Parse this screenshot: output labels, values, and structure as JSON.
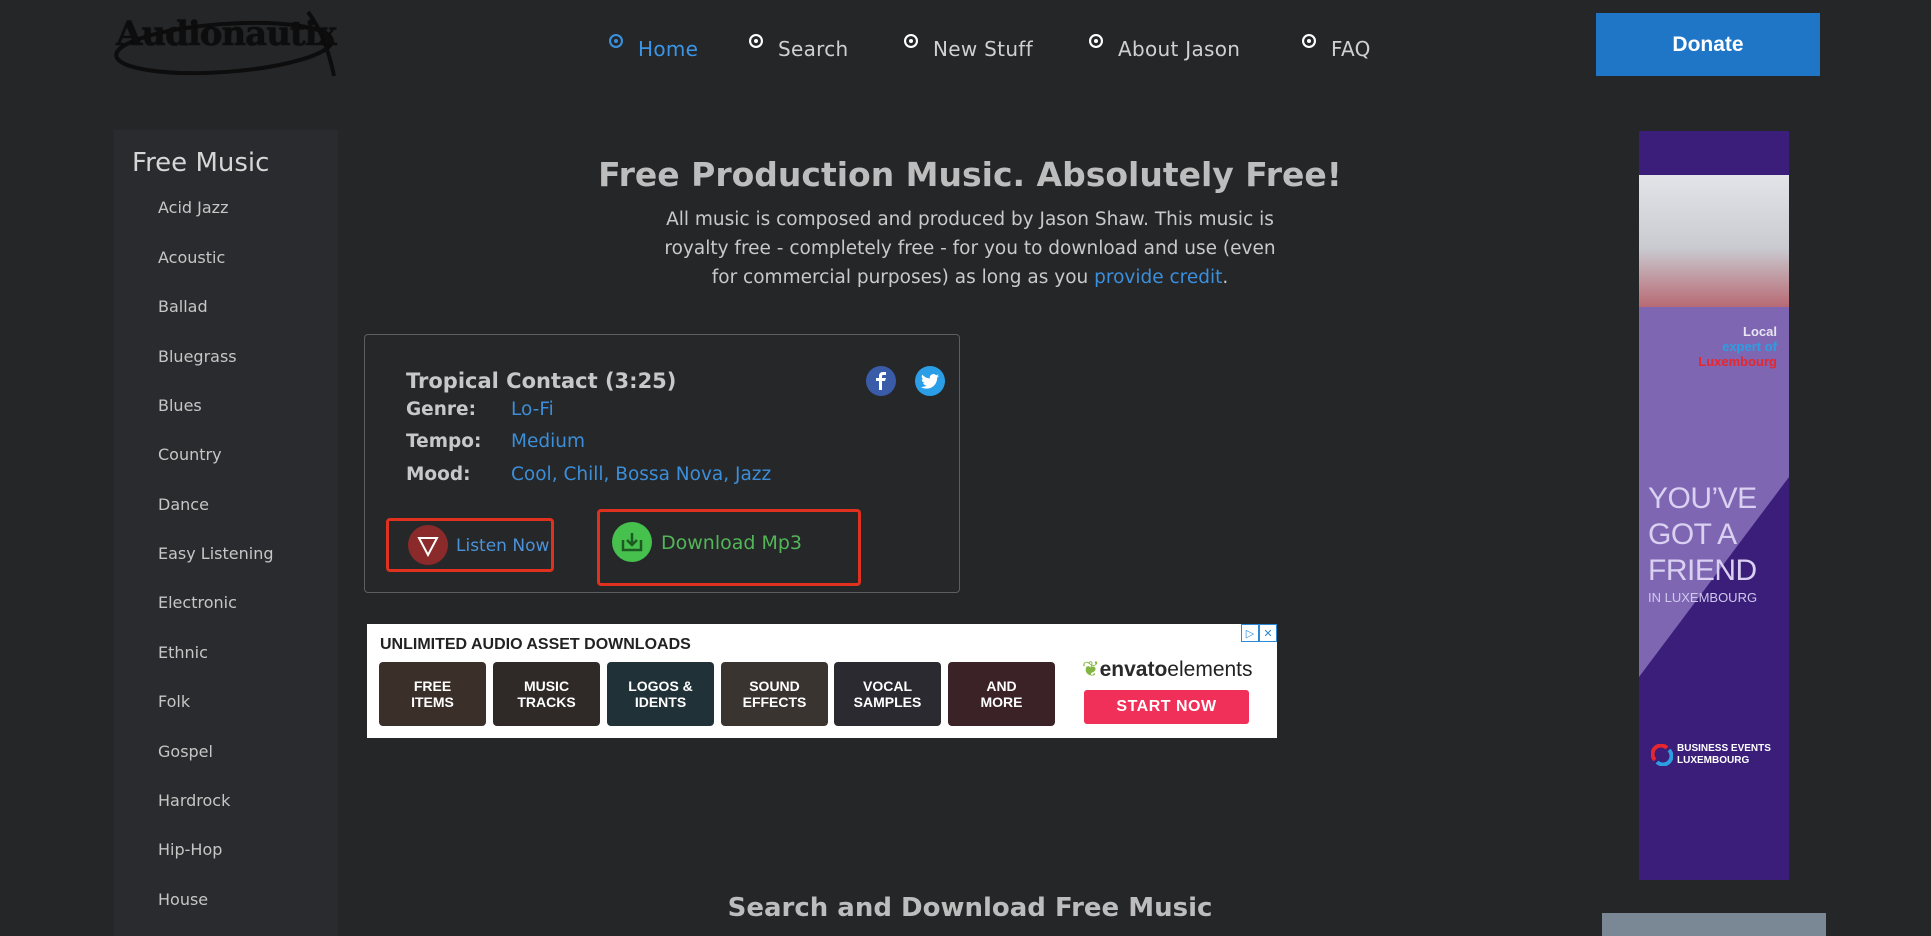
{
  "brand": {
    "logo_text": "Audionautix"
  },
  "nav": {
    "items": [
      {
        "label": "Home",
        "active": true
      },
      {
        "label": "Search",
        "active": false
      },
      {
        "label": "New Stuff",
        "active": false
      },
      {
        "label": "About Jason",
        "active": false
      },
      {
        "label": "FAQ",
        "active": false
      }
    ]
  },
  "donate": {
    "label": "Donate"
  },
  "sidebar": {
    "title": "Free Music",
    "items": [
      "Acid Jazz",
      "Acoustic",
      "Ballad",
      "Bluegrass",
      "Blues",
      "Country",
      "Dance",
      "Easy Listening",
      "Electronic",
      "Ethnic",
      "Folk",
      "Gospel",
      "Hardrock",
      "Hip-Hop",
      "House"
    ]
  },
  "hero": {
    "title": "Free Production Music. Absolutely Free!",
    "desc_line1": "All music is composed and produced by Jason Shaw. This music is",
    "desc_line2": "royalty free - completely free - for you to download and use (even",
    "desc_line3_prefix": "for commercial purposes) as long as you ",
    "desc_link": "provide credit",
    "desc_line3_suffix": "."
  },
  "track": {
    "title": "Tropical Contact (3:25)",
    "genre_label": "Genre:",
    "genre": "Lo-Fi",
    "tempo_label": "Tempo:",
    "tempo": "Medium",
    "mood_label": "Mood:",
    "mood": "Cool, Chill, Bossa Nova, Jazz",
    "listen_label": "Listen Now",
    "download_label": "Download Mp3"
  },
  "ad_banner": {
    "headline": "UNLIMITED AUDIO ASSET DOWNLOADS",
    "tiles": [
      {
        "line1": "FREE",
        "line2": "ITEMS",
        "color": "#3b2f2a"
      },
      {
        "line1": "MUSIC",
        "line2": "TRACKS",
        "color": "#2f2a28"
      },
      {
        "line1": "LOGOS &",
        "line2": "IDENTS",
        "color": "#203238"
      },
      {
        "line1": "SOUND",
        "line2": "EFFECTS",
        "color": "#3a3430"
      },
      {
        "line1": "VOCAL",
        "line2": "SAMPLES",
        "color": "#2a2a30"
      },
      {
        "line1": "AND",
        "line2": "MORE",
        "color": "#3a2226"
      }
    ],
    "brand_a": "envato",
    "brand_b": "elements",
    "cta": "START NOW"
  },
  "side_ad": {
    "local": "Local",
    "expert": "expert of",
    "lux": "Luxembourg",
    "big1": "YOU’VE",
    "big2": "GOT A",
    "big3": "FRIEND",
    "small": "IN LUXEMBOURG",
    "brand1": "BUSINESS EVENTS",
    "brand2": "LUXEMBOURG"
  },
  "search_section": {
    "heading": "Search and Download Free Music"
  },
  "colors": {
    "accent": "#3b95e6",
    "donate": "#1f76c6",
    "highlight_border": "#e0301e",
    "download_green": "#52b558"
  }
}
